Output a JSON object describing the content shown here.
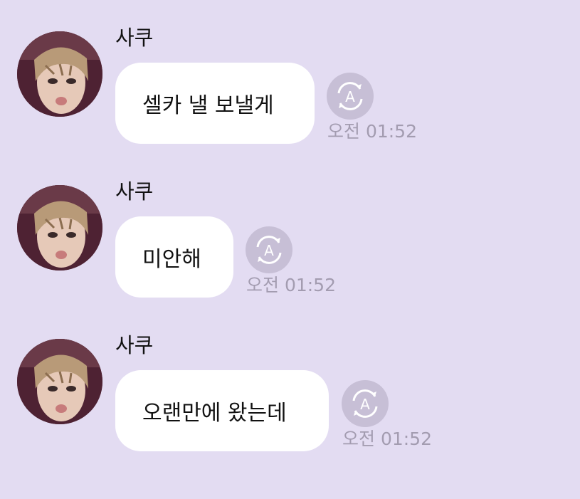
{
  "messages": [
    {
      "sender": "사쿠",
      "text": "셀카 낼 보낼게",
      "time": "오전 01:52",
      "translate_icon": "auto-translate-icon",
      "avatar": "profile-photo"
    },
    {
      "sender": "사쿠",
      "text": "미안해",
      "time": "오전 01:52",
      "translate_icon": "auto-translate-icon",
      "avatar": "profile-photo"
    },
    {
      "sender": "사쿠",
      "text": "오랜만에 왔는데",
      "time": "오전 01:52",
      "translate_icon": "auto-translate-icon",
      "avatar": "profile-photo"
    }
  ],
  "colors": {
    "background": "#e3dcf2",
    "bubble": "#ffffff",
    "translate_button": "#c7bfd6",
    "timestamp": "#a39cb0"
  }
}
